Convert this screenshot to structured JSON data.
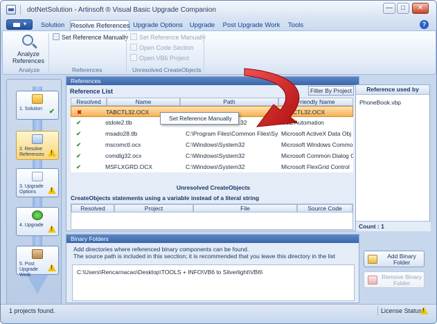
{
  "window": {
    "title": "dotNetSolution - Artinsoft ® Visual Basic Upgrade Companion",
    "minimize": "—",
    "maximize": "□",
    "close": "✕"
  },
  "ribbon_tabs": [
    "Solution",
    "Resolve References",
    "Upgrade Options",
    "Upgrade",
    "Post Upgrade Work",
    "Tools"
  ],
  "active_tab": "Resolve References",
  "help": "?",
  "ribbon": {
    "analyze_label": "Analyze References",
    "analyze_group": "Analyze",
    "set_ref_manual": "Set Reference Manually",
    "references_group": "References",
    "unres_set_ref": "Set Reference Manually",
    "unres_open_code": "Open Code Section",
    "unres_open_vb6": "Open VB6 Project",
    "unres_group": "Unresolved CreateObjects"
  },
  "steps": [
    {
      "label": "1. Solution",
      "status": "ok"
    },
    {
      "label": "2. Resolve References",
      "status": "warn"
    },
    {
      "label": "3. Upgrade Options",
      "status": "warn"
    },
    {
      "label": "4. Upgrade",
      "status": "warn"
    },
    {
      "label": "5. Post Upgrade Work",
      "status": "warn"
    }
  ],
  "references_panel": {
    "header": "References",
    "list_title": "Reference List",
    "filter_button": "Filter By Project",
    "columns": [
      "Resolved",
      "Name",
      "Path",
      "Friendly Name"
    ],
    "rows": [
      {
        "resolved": "✖",
        "name": "TABCTL32.OCX",
        "path": "",
        "friendly": "TABCTL32.OCX"
      },
      {
        "resolved": "✔",
        "name": "stdole2.tlb",
        "path": "...32",
        "friendly": "OLE Automation"
      },
      {
        "resolved": "✔",
        "name": "msado28.tlb",
        "path": "C:\\Program Files\\Common Files\\Sys",
        "friendly": "Microsoft ActiveX Data Obj"
      },
      {
        "resolved": "✔",
        "name": "mscomctl.ocx",
        "path": "C:\\Windows\\System32",
        "friendly": "Microsoft Windows Commo"
      },
      {
        "resolved": "✔",
        "name": "comdlg32.ocx",
        "path": "C:\\Windows\\System32",
        "friendly": "Microsoft Common Dialog C"
      },
      {
        "resolved": "✔",
        "name": "MSFLXGRD.OCX",
        "path": "C:\\Windows\\System32",
        "friendly": "Microsoft FlexGrid Control"
      }
    ],
    "context_menu": "Set Reference Manually",
    "unresolved_title": "Unresolved CreateObjects",
    "createobjects_label": "CreateObjects statements using a variable instead of a literal string",
    "co_columns": [
      "Resolved",
      "Project",
      "File",
      "Source Code"
    ]
  },
  "used_by": {
    "header": "Reference used by",
    "items": [
      "PhoneBook.vbp"
    ],
    "count": "Count : 1"
  },
  "binary_folders": {
    "header": "Binary Folders",
    "desc1": "Add directories where referenced binary components can be found.",
    "desc2": "The source path is included in this secction; it is recommended that you leave this directory in the list",
    "path": "C:\\Users\\Rencarnacao\\Desktop\\TOOLS + INFO\\VB6 to Silverlight\\VB6\\",
    "add_button": "Add Binary Folder",
    "remove_button": "Remove Binary Folder"
  },
  "status": {
    "left": "1 projects found.",
    "license": "License Status:"
  },
  "colors": {
    "accent": "#3b67ab",
    "selected_row": "#f7b054",
    "arrow": "#d42020",
    "ok": "#2f9b2f",
    "error": "#d21e1e",
    "warning": "#f4c400"
  }
}
